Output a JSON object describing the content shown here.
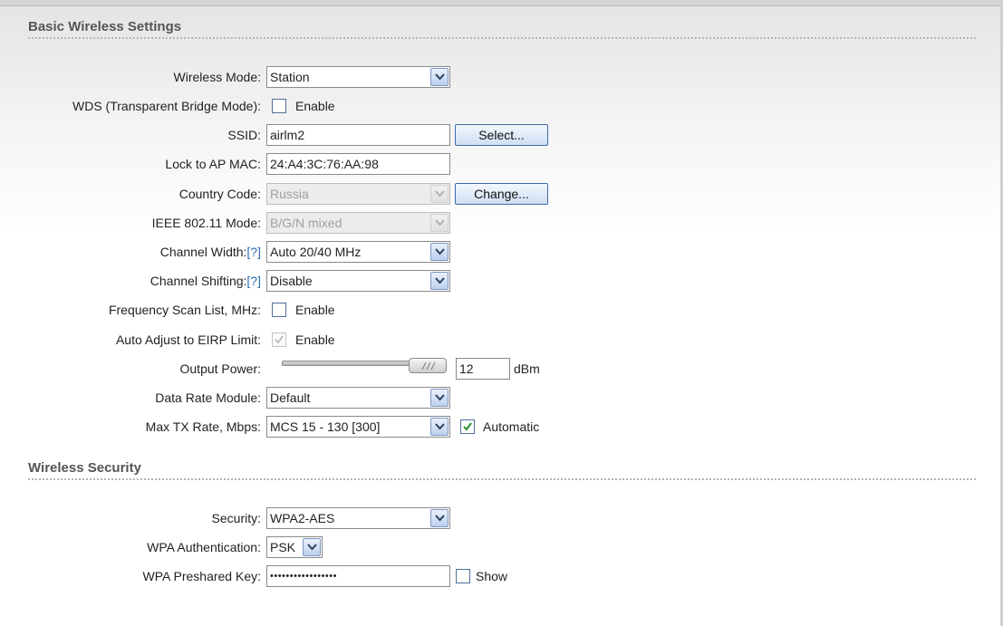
{
  "sections": {
    "basic_title": "Basic Wireless Settings",
    "security_title": "Wireless Security"
  },
  "basic": {
    "wireless_mode": {
      "label": "Wireless Mode:",
      "value": "Station"
    },
    "wds": {
      "label": "WDS (Transparent Bridge Mode):",
      "checkbox_label": "Enable",
      "checked": false
    },
    "ssid": {
      "label": "SSID:",
      "value": "airlm2",
      "button": "Select..."
    },
    "lock_ap_mac": {
      "label": "Lock to AP MAC:",
      "value": "24:A4:3C:76:AA:98"
    },
    "country_code": {
      "label": "Country Code:",
      "value": "Russia",
      "button": "Change..."
    },
    "ieee_mode": {
      "label": "IEEE 802.11 Mode:",
      "value": "B/G/N mixed"
    },
    "channel_width": {
      "label": "Channel Width:",
      "help": "[?]",
      "value": "Auto 20/40 MHz"
    },
    "channel_shifting": {
      "label": "Channel Shifting:",
      "help": "[?]",
      "value": "Disable"
    },
    "freq_scan": {
      "label": "Frequency Scan List, MHz:",
      "checkbox_label": "Enable",
      "checked": false
    },
    "auto_eirp": {
      "label": "Auto Adjust to EIRP Limit:",
      "checkbox_label": "Enable",
      "checked": true,
      "disabled": true
    },
    "output_power": {
      "label": "Output Power:",
      "value": "12",
      "unit": "dBm",
      "slider_fraction": 0.78
    },
    "data_rate_module": {
      "label": "Data Rate Module:",
      "value": "Default"
    },
    "max_tx_rate": {
      "label": "Max TX Rate, Mbps:",
      "value": "MCS 15 - 130 [300]",
      "checkbox_label": "Automatic",
      "checked": true
    }
  },
  "security": {
    "security": {
      "label": "Security:",
      "value": "WPA2-AES"
    },
    "wpa_auth": {
      "label": "WPA Authentication:",
      "value": "PSK"
    },
    "wpa_key": {
      "label": "WPA Preshared Key:",
      "value": "•••••••••••••••••",
      "checkbox_label": "Show",
      "checked": false
    }
  },
  "colors": {
    "accent": "#2a6bb5",
    "button_border": "#3e6ba6",
    "check_green": "#2b8a2b"
  }
}
